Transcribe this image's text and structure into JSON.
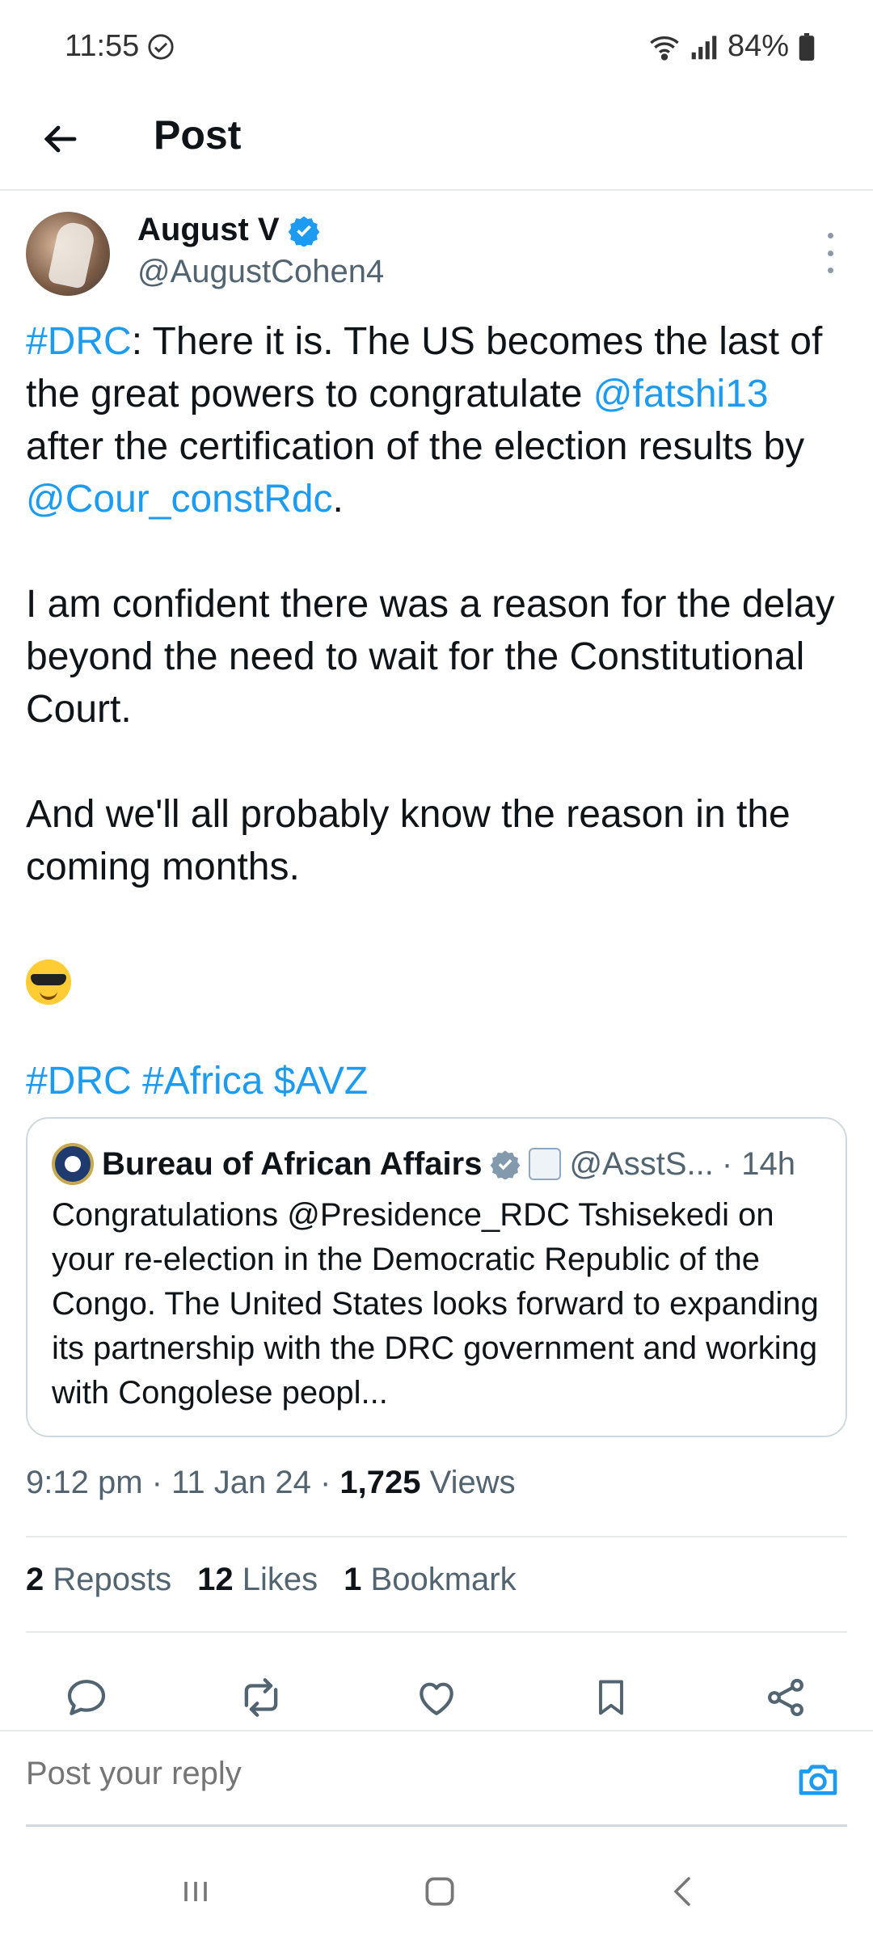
{
  "status_bar": {
    "time": "11:55",
    "battery": "84%"
  },
  "header": {
    "title": "Post"
  },
  "author": {
    "name": "August V",
    "handle": "@AugustCohen4"
  },
  "tweet": {
    "p1_tag": "#DRC",
    "p1_text_a": ": There it is. The US becomes the last of the great powers to congratulate ",
    "p1_mention1": "@fatshi13",
    "p1_text_b": " after the certification of the election results by ",
    "p1_mention2": "@Cour_constRdc",
    "p1_text_c": ".",
    "p2": "I am confident there was a reason for the delay beyond the need to wait for the Constitutional Court.",
    "p3": "And we'll all probably know the reason in the coming months.",
    "tags": "#DRC #Africa $AVZ"
  },
  "quote": {
    "name": "Bureau of African Affairs",
    "handle": "@AsstS...",
    "time": "· 14h",
    "text": "Congratulations @Presidence_RDC Tshisekedi on your re-election in the Democratic Republic of the Congo.  The United States looks forward to expanding its partnership with the DRC government and working with Congolese peopl..."
  },
  "meta": {
    "time": "9:12 pm",
    "sep1": "·",
    "date": "11 Jan 24",
    "sep2": "·",
    "views_count": "1,725",
    "views_label": "Views"
  },
  "stats": {
    "reposts_count": "2",
    "reposts_label": "Reposts",
    "likes_count": "12",
    "likes_label": "Likes",
    "bookmarks_count": "1",
    "bookmarks_label": "Bookmark"
  },
  "reply": {
    "placeholder": "Post your reply"
  },
  "icons": [
    "check-circle-icon",
    "wifi-icon",
    "signal-icon",
    "battery-icon",
    "back-arrow-icon",
    "verified-icon",
    "more-vertical-icon",
    "reply-icon",
    "repost-icon",
    "like-icon",
    "bookmark-icon",
    "share-icon",
    "camera-icon"
  ],
  "colors": {
    "accent": "#1d9bf0",
    "text": "#0f1419",
    "muted": "#536471",
    "verified_gray": "#829aab"
  }
}
